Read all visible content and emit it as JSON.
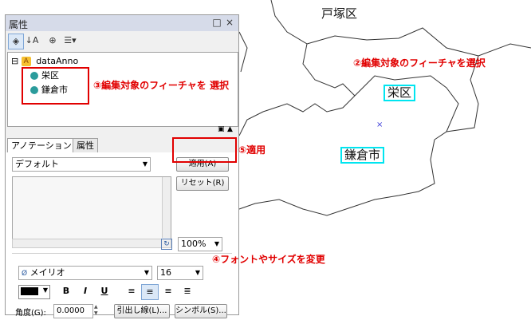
{
  "map": {
    "labels": [
      "戸塚区",
      "栄区",
      "鎌倉市"
    ],
    "highlight_color": "#00e5f0"
  },
  "panel": {
    "title": "属性",
    "titlebar_buttons": [
      "pin-icon",
      "close-icon"
    ],
    "tree": {
      "layer": "dataAnno",
      "items": [
        "栄区",
        "鎌倉市"
      ]
    },
    "tabs": [
      "アノテーション",
      "属性"
    ],
    "template_value": "デフォルト",
    "apply_label": "適用(A)",
    "reset_label": "リセット(R)",
    "zoom_value": "100%",
    "font_value": "メイリオ",
    "size_value": "16",
    "color_value": "#000000",
    "format_buttons": [
      "B",
      "I",
      "U"
    ],
    "angle_label": "角度(G):",
    "angle_value": "0.0000",
    "leader_label": "引出し線(L)...",
    "symbol_label": "シンボル(S)..."
  },
  "annotations": {
    "step2": "②編集対象のフィーチャを選択",
    "step3": "③編集対象のフィーチャを 選択",
    "step4": "④フォントやサイズを変更",
    "step5": "⑤適用",
    "color": "#e10000"
  }
}
